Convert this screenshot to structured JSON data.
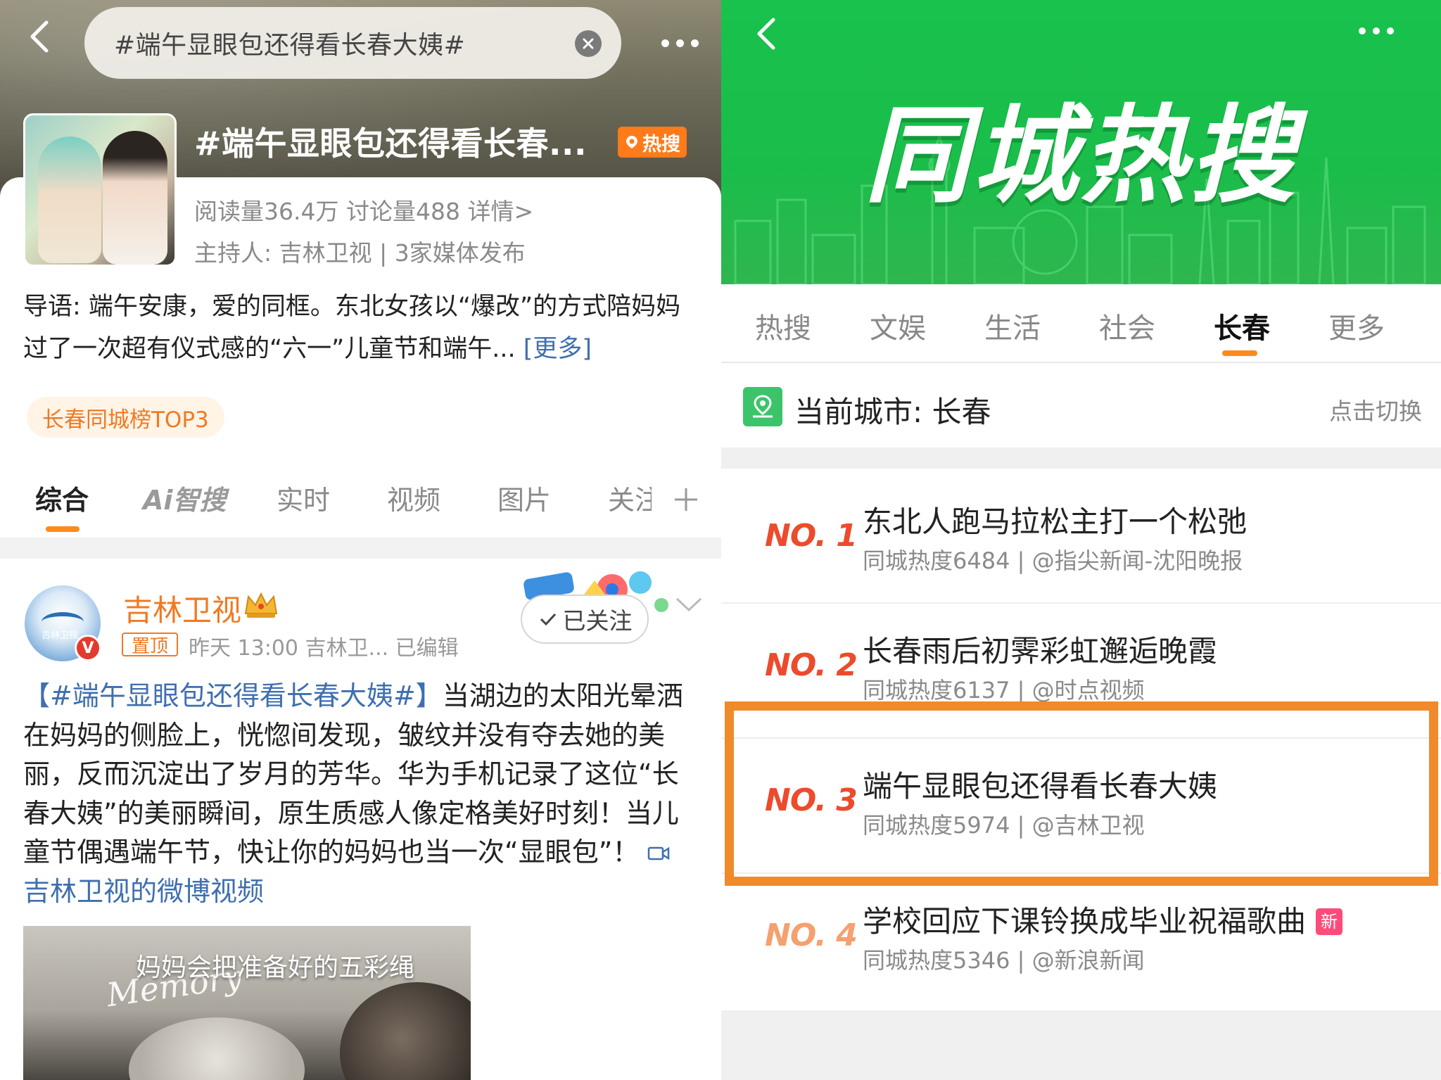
{
  "left": {
    "search": {
      "query": "#端午显眼包还得看长春大姨#"
    },
    "topic": {
      "title": "#端午显眼包还得看长春...",
      "hot_badge": "热搜",
      "stats": "阅读量36.4万  讨论量488  详情>",
      "host": "主持人:  吉林卫视 | 3家媒体发布",
      "intro": "导语:  端午安康，爱的同框。东北女孩以“爆改”的方式陪妈妈过了一次超有仪式感的“六一”儿童节和端午... ",
      "intro_more": "[更多]",
      "city_tag": "长春同城榜TOP3"
    },
    "tabs": [
      "综合",
      "Ai智搜",
      "实时",
      "视频",
      "图片",
      "关注"
    ],
    "post": {
      "author": "吉林卫视",
      "avatar_label": "吉林卫视",
      "pin_label": "置顶",
      "meta": "昨天 13:00   吉林卫...   已编辑",
      "follow_label": "已关注",
      "hashtag": "【#端午显眼包还得看长春大姨#】",
      "body": "当湖边的太阳光晕洒在妈妈的侧脸上，恍惚间发现，皱纹并没有夺去她的美丽，反而沉淀出了岁月的芳华。华为手机记录了这位“长春大姨”的美丽瞬间，原生质感人像定格美好时刻！当儿童节偶遇端午节，快让你的妈妈也当一次“显眼包”！ ",
      "video_link": "吉林卫视的微博视频",
      "video_caption": "妈妈会把准备好的五彩绳",
      "video_script": "Memory"
    }
  },
  "right": {
    "banner_title": "同城热搜",
    "tabs": [
      "热搜",
      "文娱",
      "生活",
      "社会",
      "长春",
      "更多"
    ],
    "active_tab": "长春",
    "city_label": "当前城市: 长春",
    "switch_label": "点击切换",
    "items": [
      {
        "rank": "NO. 1",
        "title": "东北人跑马拉松主打一个松弛",
        "sub": "同城热度6484 | @指尖新闻-沈阳晚报"
      },
      {
        "rank": "NO. 2",
        "title": "长春雨后初霁彩虹邂逅晚霞",
        "sub": "同城热度6137 | @时点视频"
      },
      {
        "rank": "NO. 3",
        "title": "端午显眼包还得看长春大姨",
        "sub": "同城热度5974 | @吉林卫视"
      },
      {
        "rank": "NO. 4",
        "title": "学校回应下课铃换成毕业祝福歌曲",
        "sub": "同城热度5346 | @新浪新闻",
        "badge": "新"
      }
    ]
  },
  "colors": {
    "accent_orange": "#ff8a1c",
    "highlight_border": "#f08a2a",
    "banner_green": "#18c24c",
    "link_blue": "#3f6fb0",
    "rank_red": "#ec4b2c"
  }
}
